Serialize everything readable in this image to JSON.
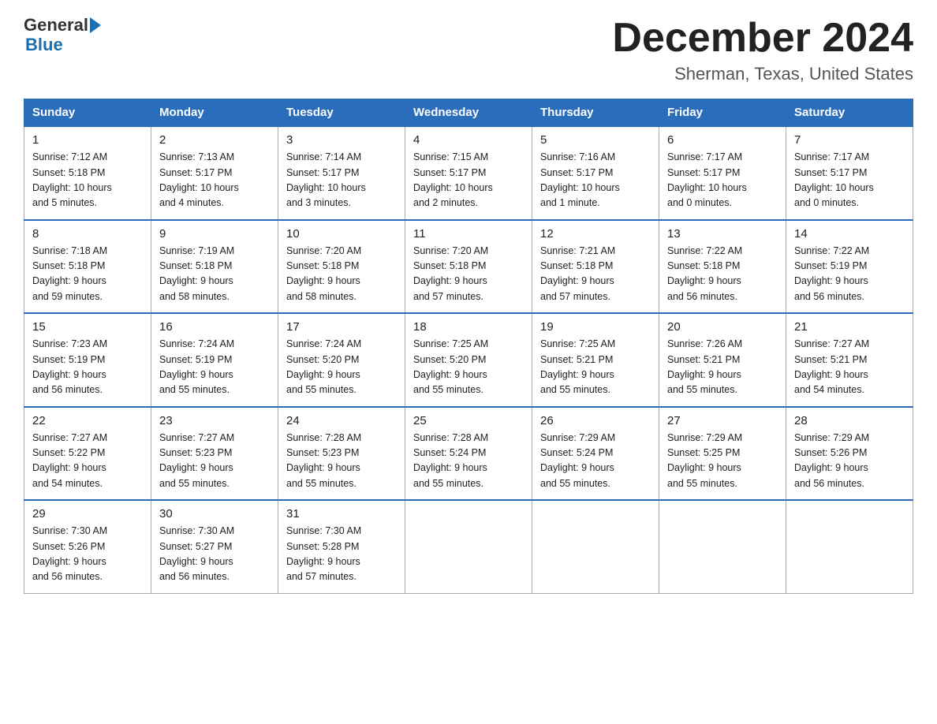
{
  "header": {
    "logo_line1": "General",
    "logo_line2": "Blue",
    "month": "December 2024",
    "location": "Sherman, Texas, United States"
  },
  "weekdays": [
    "Sunday",
    "Monday",
    "Tuesday",
    "Wednesday",
    "Thursday",
    "Friday",
    "Saturday"
  ],
  "weeks": [
    [
      {
        "day": "1",
        "info": "Sunrise: 7:12 AM\nSunset: 5:18 PM\nDaylight: 10 hours\nand 5 minutes."
      },
      {
        "day": "2",
        "info": "Sunrise: 7:13 AM\nSunset: 5:17 PM\nDaylight: 10 hours\nand 4 minutes."
      },
      {
        "day": "3",
        "info": "Sunrise: 7:14 AM\nSunset: 5:17 PM\nDaylight: 10 hours\nand 3 minutes."
      },
      {
        "day": "4",
        "info": "Sunrise: 7:15 AM\nSunset: 5:17 PM\nDaylight: 10 hours\nand 2 minutes."
      },
      {
        "day": "5",
        "info": "Sunrise: 7:16 AM\nSunset: 5:17 PM\nDaylight: 10 hours\nand 1 minute."
      },
      {
        "day": "6",
        "info": "Sunrise: 7:17 AM\nSunset: 5:17 PM\nDaylight: 10 hours\nand 0 minutes."
      },
      {
        "day": "7",
        "info": "Sunrise: 7:17 AM\nSunset: 5:17 PM\nDaylight: 10 hours\nand 0 minutes."
      }
    ],
    [
      {
        "day": "8",
        "info": "Sunrise: 7:18 AM\nSunset: 5:18 PM\nDaylight: 9 hours\nand 59 minutes."
      },
      {
        "day": "9",
        "info": "Sunrise: 7:19 AM\nSunset: 5:18 PM\nDaylight: 9 hours\nand 58 minutes."
      },
      {
        "day": "10",
        "info": "Sunrise: 7:20 AM\nSunset: 5:18 PM\nDaylight: 9 hours\nand 58 minutes."
      },
      {
        "day": "11",
        "info": "Sunrise: 7:20 AM\nSunset: 5:18 PM\nDaylight: 9 hours\nand 57 minutes."
      },
      {
        "day": "12",
        "info": "Sunrise: 7:21 AM\nSunset: 5:18 PM\nDaylight: 9 hours\nand 57 minutes."
      },
      {
        "day": "13",
        "info": "Sunrise: 7:22 AM\nSunset: 5:18 PM\nDaylight: 9 hours\nand 56 minutes."
      },
      {
        "day": "14",
        "info": "Sunrise: 7:22 AM\nSunset: 5:19 PM\nDaylight: 9 hours\nand 56 minutes."
      }
    ],
    [
      {
        "day": "15",
        "info": "Sunrise: 7:23 AM\nSunset: 5:19 PM\nDaylight: 9 hours\nand 56 minutes."
      },
      {
        "day": "16",
        "info": "Sunrise: 7:24 AM\nSunset: 5:19 PM\nDaylight: 9 hours\nand 55 minutes."
      },
      {
        "day": "17",
        "info": "Sunrise: 7:24 AM\nSunset: 5:20 PM\nDaylight: 9 hours\nand 55 minutes."
      },
      {
        "day": "18",
        "info": "Sunrise: 7:25 AM\nSunset: 5:20 PM\nDaylight: 9 hours\nand 55 minutes."
      },
      {
        "day": "19",
        "info": "Sunrise: 7:25 AM\nSunset: 5:21 PM\nDaylight: 9 hours\nand 55 minutes."
      },
      {
        "day": "20",
        "info": "Sunrise: 7:26 AM\nSunset: 5:21 PM\nDaylight: 9 hours\nand 55 minutes."
      },
      {
        "day": "21",
        "info": "Sunrise: 7:27 AM\nSunset: 5:21 PM\nDaylight: 9 hours\nand 54 minutes."
      }
    ],
    [
      {
        "day": "22",
        "info": "Sunrise: 7:27 AM\nSunset: 5:22 PM\nDaylight: 9 hours\nand 54 minutes."
      },
      {
        "day": "23",
        "info": "Sunrise: 7:27 AM\nSunset: 5:23 PM\nDaylight: 9 hours\nand 55 minutes."
      },
      {
        "day": "24",
        "info": "Sunrise: 7:28 AM\nSunset: 5:23 PM\nDaylight: 9 hours\nand 55 minutes."
      },
      {
        "day": "25",
        "info": "Sunrise: 7:28 AM\nSunset: 5:24 PM\nDaylight: 9 hours\nand 55 minutes."
      },
      {
        "day": "26",
        "info": "Sunrise: 7:29 AM\nSunset: 5:24 PM\nDaylight: 9 hours\nand 55 minutes."
      },
      {
        "day": "27",
        "info": "Sunrise: 7:29 AM\nSunset: 5:25 PM\nDaylight: 9 hours\nand 55 minutes."
      },
      {
        "day": "28",
        "info": "Sunrise: 7:29 AM\nSunset: 5:26 PM\nDaylight: 9 hours\nand 56 minutes."
      }
    ],
    [
      {
        "day": "29",
        "info": "Sunrise: 7:30 AM\nSunset: 5:26 PM\nDaylight: 9 hours\nand 56 minutes."
      },
      {
        "day": "30",
        "info": "Sunrise: 7:30 AM\nSunset: 5:27 PM\nDaylight: 9 hours\nand 56 minutes."
      },
      {
        "day": "31",
        "info": "Sunrise: 7:30 AM\nSunset: 5:28 PM\nDaylight: 9 hours\nand 57 minutes."
      },
      null,
      null,
      null,
      null
    ]
  ]
}
